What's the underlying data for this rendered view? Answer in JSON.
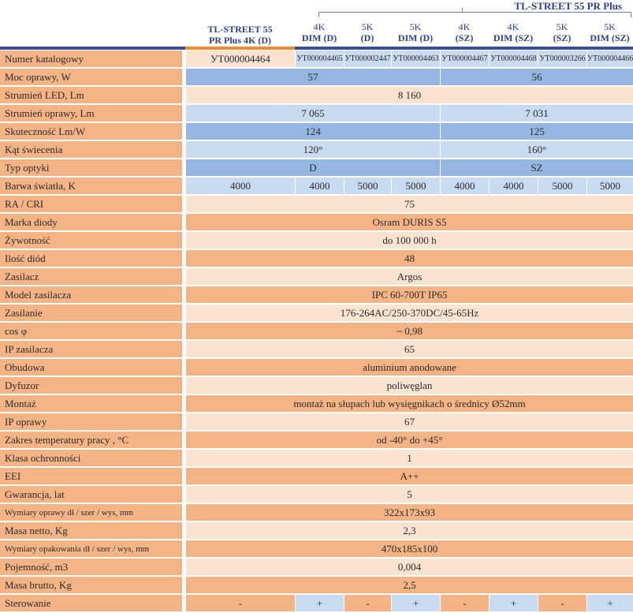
{
  "header": {
    "group_title": "TL-STREET 55 PR Plus",
    "first_model_line1": "TL-STREET 55",
    "first_model_line2": "PR Plus 4K (D)",
    "variants": [
      {
        "line1": "4K",
        "line2": "DIM (D)"
      },
      {
        "line1": "5K",
        "line2": "(D)"
      },
      {
        "line1": "5K",
        "line2": "DIM (D)"
      },
      {
        "line1": "4K",
        "line2": "(SZ)"
      },
      {
        "line1": "4K",
        "line2": "DIM (SZ)"
      },
      {
        "line1": "5K",
        "line2": "(SZ)"
      },
      {
        "line1": "5K",
        "line2": "DIM (SZ)"
      }
    ]
  },
  "rows": [
    {
      "label": "Numer katalogowy",
      "cells": [
        "УТ000004464",
        "УТ000004465",
        "УТ000002447",
        "УТ000004463",
        "УТ000004467",
        "УТ000004468",
        "УТ000003266",
        "УТ000004466"
      ]
    },
    {
      "label": "Moc oprawy, W",
      "cells": [
        "57",
        "56"
      ]
    },
    {
      "label": "Strumień LED, Lm",
      "cells": [
        "8 160"
      ]
    },
    {
      "label": "Strumień oprawy, Lm",
      "cells": [
        "7 065",
        "7 031"
      ]
    },
    {
      "label": "Skuteczność Lm/W",
      "cells": [
        "124",
        "125"
      ]
    },
    {
      "label": "Kąt świecenia",
      "cells": [
        "120°",
        "160°"
      ]
    },
    {
      "label": "Typ optyki",
      "cells": [
        "D",
        "SZ"
      ]
    },
    {
      "label": "Barwa światła, K",
      "cells": [
        "4000",
        "4000",
        "5000",
        "5000",
        "4000",
        "4000",
        "5000",
        "5000"
      ]
    },
    {
      "label": "RA / CRI",
      "cells": [
        "75"
      ]
    },
    {
      "label": "Marka diody",
      "cells": [
        "Osram DURIS S5"
      ]
    },
    {
      "label": "Żywotność",
      "cells": [
        "do 100 000 h"
      ]
    },
    {
      "label": "Ilość diód",
      "cells": [
        "48"
      ]
    },
    {
      "label": "Zasilacz",
      "cells": [
        "Argos"
      ]
    },
    {
      "label": "Model zasilacza",
      "cells": [
        "IPC 60-700T IP65"
      ]
    },
    {
      "label": "Zasilanie",
      "cells": [
        "176-264AC/250-370DC/45-65Hz"
      ]
    },
    {
      "label": "cos φ",
      "cells": [
        "~ 0,98"
      ]
    },
    {
      "label": "IP zasilacza",
      "cells": [
        "65"
      ]
    },
    {
      "label": "Obudowa",
      "cells": [
        "aluminium anodowane"
      ]
    },
    {
      "label": "Dyfuzor",
      "cells": [
        "poliwęglan"
      ]
    },
    {
      "label": "Montaż",
      "cells": [
        "montaż na słupach lub wysięgnikach o średnicy Ø52mm"
      ]
    },
    {
      "label": "IP oprawy",
      "cells": [
        "67"
      ]
    },
    {
      "label": "Zakres temperatury pracy , °C",
      "cells": [
        "od -40° do +45°"
      ]
    },
    {
      "label": "Klasa ochronności",
      "cells": [
        "1"
      ]
    },
    {
      "label": "EEI",
      "cells": [
        "A++"
      ]
    },
    {
      "label": "Gwarancja, lat",
      "cells": [
        "5"
      ]
    },
    {
      "label": "Wymiary oprawy dł / szer / wys, mm",
      "cells": [
        "322x173x93"
      ]
    },
    {
      "label": "Masa netto, Kg",
      "cells": [
        "2,3"
      ]
    },
    {
      "label": "Wymiary opakowania dł / szer / wys, mm",
      "cells": [
        "470x185x100"
      ]
    },
    {
      "label": "Pojemność, m3",
      "cells": [
        "0,004"
      ]
    },
    {
      "label": "Masa brutto, Kg",
      "cells": [
        "2,5"
      ]
    },
    {
      "label": "Sterowanie",
      "cells": [
        "-",
        "+",
        "-",
        "+",
        "-",
        "+",
        "-",
        "+"
      ]
    }
  ],
  "colors": {
    "label_bg": "#f4b486",
    "light_peach": "#fbe3d2",
    "light_blue": "#c9dbf1",
    "blue": "#95b6e0",
    "header_text": "#2e3f8f",
    "accent_orange": "#f28a2e"
  }
}
